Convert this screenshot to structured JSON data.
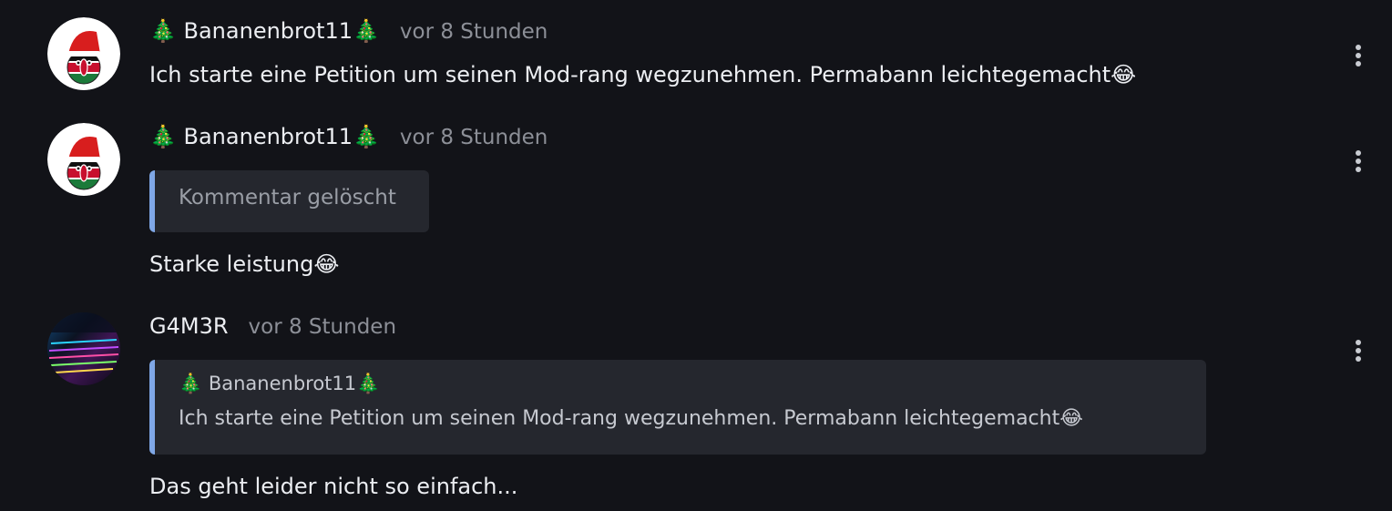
{
  "comments": [
    {
      "author": "🎄 Bananenbrot11🎄",
      "time": "vor 8 Stunden",
      "text": "Ich starte eine Petition um seinen Mod-rang wegzunehmen. Permabann leichtegemacht😂",
      "avatar": "santa-kenya-ball-avatar"
    },
    {
      "author": "🎄 Bananenbrot11🎄",
      "time": "vor 8 Stunden",
      "quote": {
        "deleted_label": "Kommentar gelöscht"
      },
      "text": "Starke leistung😂",
      "avatar": "santa-kenya-ball-avatar"
    },
    {
      "author": "G4M3R",
      "time": "vor 8 Stunden",
      "quote": {
        "author": "🎄 Bananenbrot11🎄",
        "text": "Ich starte eine Petition um seinen Mod-rang wegzunehmen. Permabann leichtegemacht😂"
      },
      "text": "Das geht leider nicht so einfach...",
      "avatar": "rgb-keyboard-avatar"
    }
  ],
  "colors": {
    "background": "#121318",
    "quote_background": "#25272e",
    "quote_accent": "#7fa7e6",
    "muted_text": "#8c8f97"
  }
}
